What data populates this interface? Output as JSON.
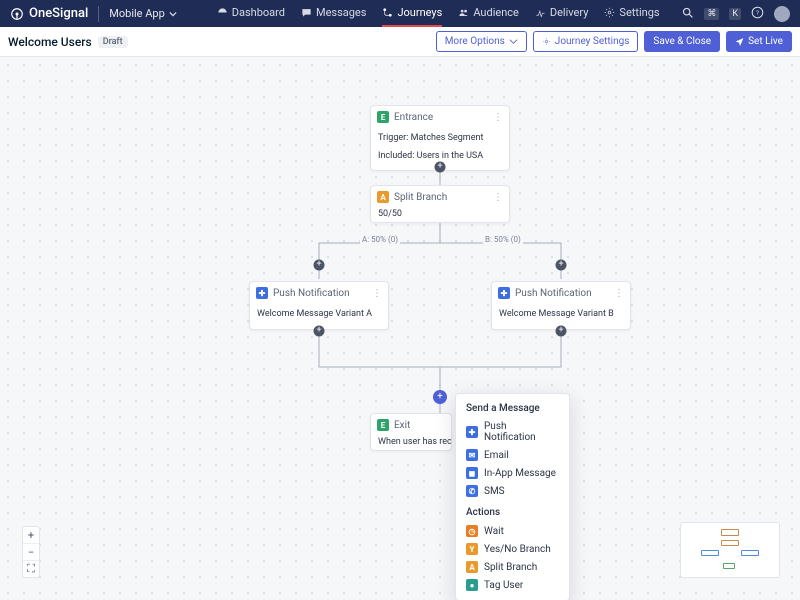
{
  "brand": "OneSignal",
  "app_switcher": "Mobile App",
  "nav": {
    "dashboard": "Dashboard",
    "messages": "Messages",
    "journeys": "Journeys",
    "audience": "Audience",
    "delivery": "Delivery",
    "settings": "Settings"
  },
  "shortcut": {
    "cmd": "⌘",
    "k": "K"
  },
  "journey": {
    "title": "Welcome Users",
    "status": "Draft"
  },
  "toolbar": {
    "more": "More Options",
    "journey_settings": "Journey Settings",
    "save_close": "Save & Close",
    "set_live": "Set Live"
  },
  "nodes": {
    "entrance": {
      "title": "Entrance",
      "trigger": "Trigger: Matches Segment",
      "included": "Included: Users in the USA"
    },
    "split": {
      "title": "Split Branch",
      "ratio": "50/50"
    },
    "edge_a": "A: 50% (0)",
    "edge_b": "B: 50% (0)",
    "push_a": {
      "title": "Push Notification",
      "body": "Welcome Message Variant A"
    },
    "push_b": {
      "title": "Push Notification",
      "body": "Welcome Message Variant B"
    },
    "exit": {
      "title": "Exit",
      "body": "When user has received all"
    }
  },
  "popover": {
    "section1": "Send a Message",
    "push": "Push Notification",
    "email": "Email",
    "inapp": "In-App Message",
    "sms": "SMS",
    "section2": "Actions",
    "wait": "Wait",
    "yesno": "Yes/No Branch",
    "split": "Split Branch",
    "tag": "Tag User"
  }
}
